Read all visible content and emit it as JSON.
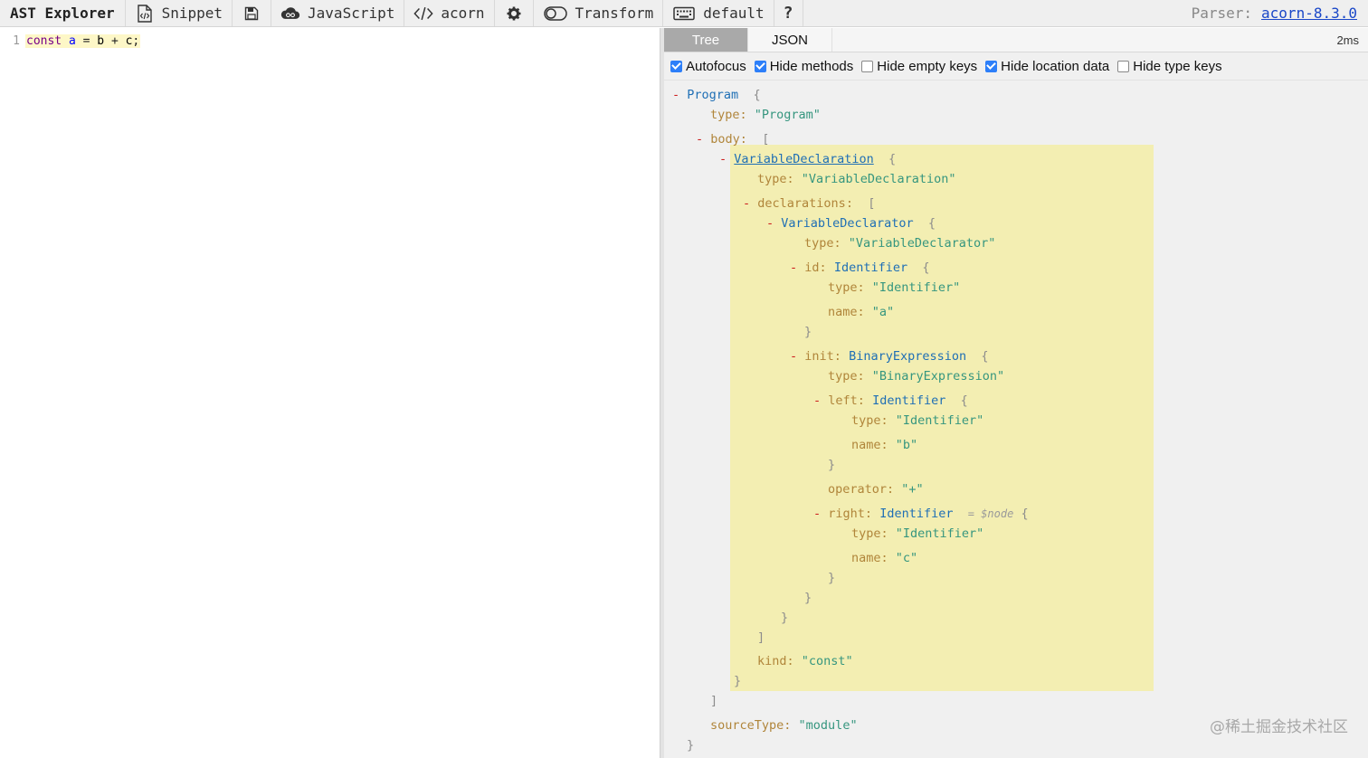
{
  "toolbar": {
    "title": "AST Explorer",
    "snippet": "Snippet",
    "language": "JavaScript",
    "parser": "acorn",
    "transform": "Transform",
    "keymap": "default",
    "help": "?",
    "parser_label": "Parser:",
    "parser_version": "acorn-8.3.0"
  },
  "editor": {
    "line_number": "1",
    "code": {
      "kw": "const",
      "name": "a",
      "eq": "=",
      "lhs": "b",
      "plus": "+",
      "rhs": "c",
      "semi": ";"
    }
  },
  "output": {
    "tabs": [
      {
        "label": "Tree"
      },
      {
        "label": "JSON"
      }
    ],
    "time": "2ms",
    "options": [
      {
        "label": "Autofocus",
        "checked": true
      },
      {
        "label": "Hide methods",
        "checked": true
      },
      {
        "label": "Hide empty keys",
        "checked": false
      },
      {
        "label": "Hide location data",
        "checked": true
      },
      {
        "label": "Hide type keys",
        "checked": false
      }
    ]
  },
  "tree": {
    "toggle": "-",
    "brace_open": "{",
    "brace_close": "}",
    "bracket_open": "[",
    "bracket_close": "]",
    "program": "Program",
    "type_key": "type:",
    "program_type": "\"Program\"",
    "body_key": "body:",
    "var_decl": "VariableDeclaration",
    "var_decl_type": "\"VariableDeclaration\"",
    "declarations_key": "declarations:",
    "declarator": "VariableDeclarator",
    "declarator_type": "\"VariableDeclarator\"",
    "id_key": "id:",
    "identifier": "Identifier",
    "identifier_type": "\"Identifier\"",
    "name_key": "name:",
    "name_a": "\"a\"",
    "init_key": "init:",
    "binary": "BinaryExpression",
    "binary_type": "\"BinaryExpression\"",
    "left_key": "left:",
    "name_b": "\"b\"",
    "operator_key": "operator:",
    "operator_val": "\"+\"",
    "right_key": "right:",
    "node_ann": "= $node",
    "name_c": "\"c\"",
    "kind_key": "kind:",
    "kind_val": "\"const\"",
    "source_type_key": "sourceType:",
    "source_type_val": "\"module\""
  },
  "watermark": "@稀土掘金技术社区"
}
